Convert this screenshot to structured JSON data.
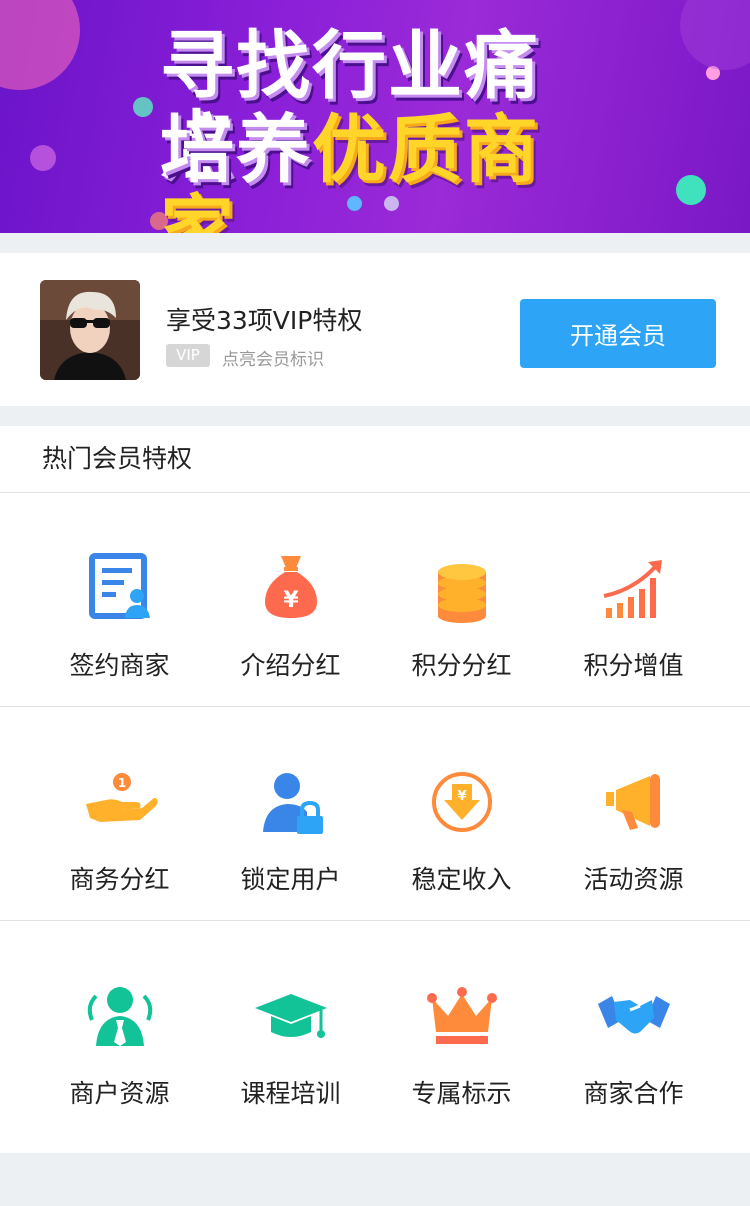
{
  "banner": {
    "line1": "寻找行业痛点",
    "line2_a": "培养",
    "line2_b": "优质商家",
    "slides": 2,
    "active_slide": 1
  },
  "member": {
    "title": "享受33项VIP特权",
    "vip_badge": "VIP",
    "subtitle": "点亮会员标识",
    "button": "开通会员"
  },
  "privileges": {
    "heading": "热门会员特权",
    "rows": [
      [
        {
          "label": "签约商家",
          "icon": "contract-icon"
        },
        {
          "label": "介绍分红",
          "icon": "money-bag-icon"
        },
        {
          "label": "积分分红",
          "icon": "coin-stack-icon"
        },
        {
          "label": "积分增值",
          "icon": "growth-chart-icon"
        }
      ],
      [
        {
          "label": "商务分红",
          "icon": "hand-coin-icon"
        },
        {
          "label": "锁定用户",
          "icon": "user-lock-icon"
        },
        {
          "label": "稳定收入",
          "icon": "income-icon"
        },
        {
          "label": "活动资源",
          "icon": "megaphone-icon"
        }
      ],
      [
        {
          "label": "商户资源",
          "icon": "merchant-icon"
        },
        {
          "label": "课程培训",
          "icon": "graduation-cap-icon"
        },
        {
          "label": "专属标示",
          "icon": "crown-icon"
        },
        {
          "label": "商家合作",
          "icon": "handshake-icon"
        }
      ]
    ]
  },
  "colors": {
    "primary": "#2ea4f7",
    "icon_blue": "#3a86e8",
    "icon_orange": "#fe8b3c",
    "icon_red": "#fe6a4d",
    "icon_yellow": "#ffb12b",
    "icon_green": "#13c398"
  }
}
